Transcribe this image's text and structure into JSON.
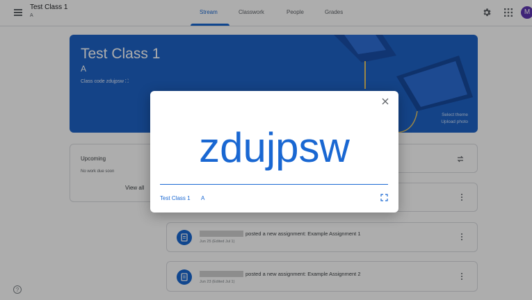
{
  "header": {
    "class_title": "Test Class 1",
    "class_subtitle": "A",
    "tabs": [
      {
        "label": "Stream",
        "active": true
      },
      {
        "label": "Classwork"
      },
      {
        "label": "People"
      },
      {
        "label": "Grades"
      }
    ],
    "avatar_initial": "M"
  },
  "banner": {
    "title": "Test Class 1",
    "section": "A",
    "class_code_label": "Class code",
    "class_code": "zdujpsw",
    "select_theme": "Select theme",
    "upload_photo": "Upload photo",
    "color": "#1e63c7"
  },
  "upcoming": {
    "title": "Upcoming",
    "empty_text": "No work due soon",
    "view_all": "View all"
  },
  "stream": [
    {
      "text": "posted a new assignment: Example Assignment 1",
      "date": "Jun 25 (Edited Jul 1)"
    },
    {
      "text": "posted a new assignment: Example Assignment 2",
      "date": "Jun 23 (Edited Jul 1)"
    }
  ],
  "dialog": {
    "code": "zdujpsw",
    "class_name": "Test Class 1",
    "section": "A"
  },
  "colors": {
    "accent": "#1967d2",
    "avatar": "#5e35b1"
  }
}
